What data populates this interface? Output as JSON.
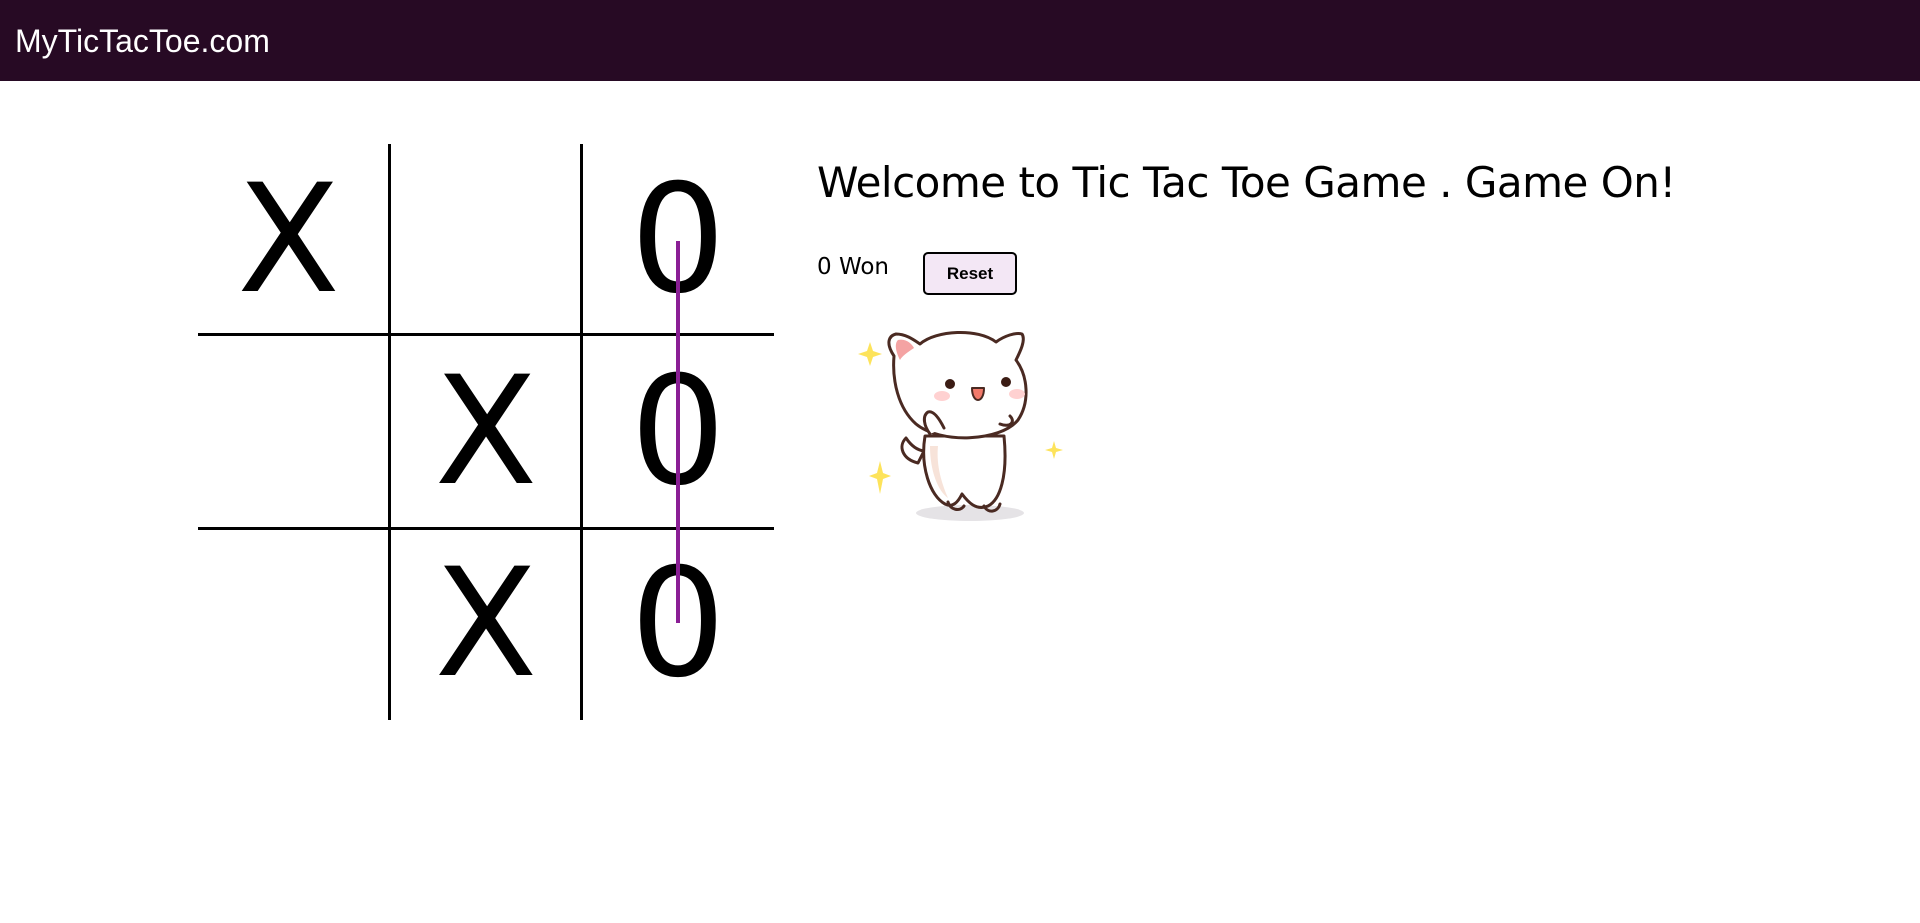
{
  "navbar": {
    "brand": "MyTicTacToe.com"
  },
  "board": {
    "cells": [
      [
        "X",
        "",
        "0"
      ],
      [
        "",
        "X",
        "0"
      ],
      [
        "",
        "X",
        "0"
      ]
    ],
    "winning_line": "column-3"
  },
  "main": {
    "welcome": "Welcome to Tic Tac Toe Game . Game On!",
    "won_text": "0 Won",
    "reset_label": "Reset"
  },
  "colors": {
    "navbar_bg": "#270a24",
    "win_line": "#8a1e95",
    "reset_bg": "#f3e7f5"
  },
  "icons": {
    "celebration": "dancing-cat-sticker"
  }
}
